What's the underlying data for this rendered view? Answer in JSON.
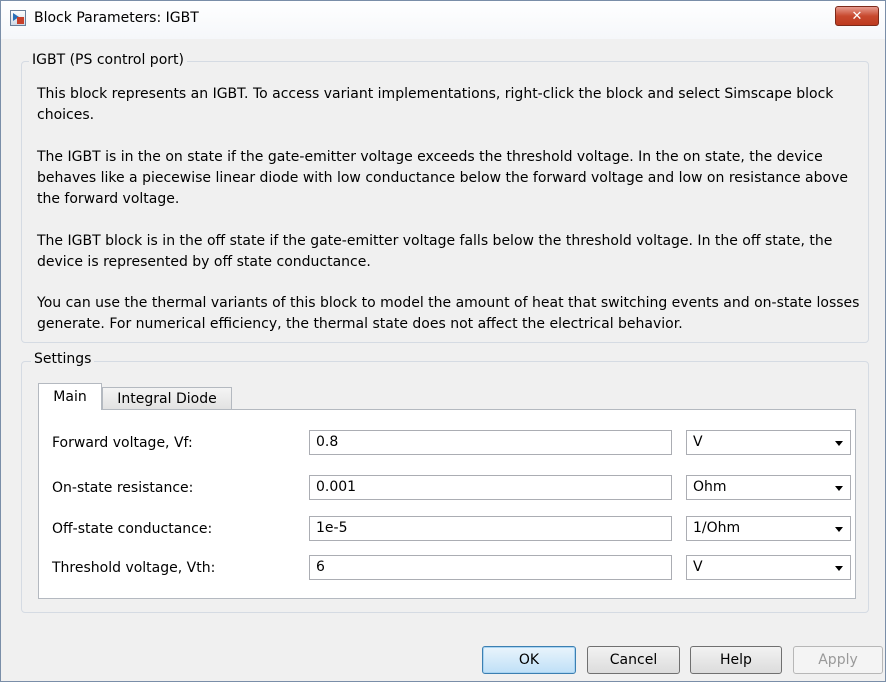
{
  "window": {
    "title": "Block Parameters: IGBT",
    "close_label": "✕"
  },
  "description": {
    "group_label": "IGBT (PS control port)",
    "paragraphs": [
      "This block represents an IGBT. To access variant implementations, right-click the block and select Simscape block choices.",
      "The IGBT is in the on state if the gate-emitter voltage exceeds the threshold voltage. In the on state, the device behaves like a piecewise linear diode with low conductance below the forward voltage and low on resistance above the forward voltage.",
      "The IGBT block is in the off state if the gate-emitter voltage falls below the threshold voltage. In the off state, the device is represented by off state conductance.",
      "You can use the thermal variants of this block to model the amount of heat that switching events and on-state losses generate. For numerical efficiency, the thermal state does not affect the electrical behavior."
    ]
  },
  "settings": {
    "group_label": "Settings",
    "tabs": [
      {
        "label": "Main",
        "active": true
      },
      {
        "label": "Integral Diode",
        "active": false
      }
    ],
    "parameters": [
      {
        "label": "Forward voltage, Vf:",
        "value": "0.8",
        "unit": "V"
      },
      {
        "label": "On-state resistance:",
        "value": "0.001",
        "unit": "Ohm"
      },
      {
        "label": "Off-state conductance:",
        "value": "1e-5",
        "unit": "1/Ohm"
      },
      {
        "label": "Threshold voltage, Vth:",
        "value": "6",
        "unit": "V"
      }
    ]
  },
  "buttons": {
    "ok": "OK",
    "cancel": "Cancel",
    "help": "Help",
    "apply": "Apply"
  },
  "colors": {
    "window_bg": "#f0f0f0",
    "close_button": "#c8492f",
    "default_button": "#bfe0f7"
  }
}
